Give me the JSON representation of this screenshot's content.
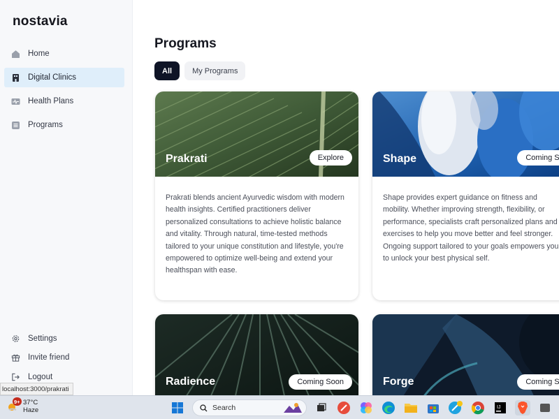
{
  "sidebar": {
    "logo": "nostavia",
    "items": [
      {
        "label": "Home",
        "icon": "home-icon"
      },
      {
        "label": "Digital Clinics",
        "icon": "clinic-icon",
        "active": true
      },
      {
        "label": "Health Plans",
        "icon": "heartbeat-icon"
      },
      {
        "label": "Programs",
        "icon": "list-icon"
      }
    ],
    "bottom_items": [
      {
        "label": "Settings",
        "icon": "gear-icon"
      },
      {
        "label": "Invite friend",
        "icon": "gift-icon"
      },
      {
        "label": "Logout",
        "icon": "logout-icon"
      }
    ]
  },
  "main": {
    "title": "Programs",
    "tabs": [
      {
        "label": "All",
        "active": true
      },
      {
        "label": "My Programs",
        "active": false
      }
    ],
    "cards": [
      {
        "name": "Prakrati",
        "button": "Explore",
        "description": "Prakrati blends ancient Ayurvedic wisdom with modern health insights. Certified practitioners deliver personalized consultations to achieve holistic balance and vitality. Through natural, time-tested methods tailored to your unique constitution and lifestyle, you're empowered to optimize well-being and extend your healthspan with ease."
      },
      {
        "name": "Shape",
        "button": "Coming Soon",
        "description": "Shape provides expert guidance on fitness and mobility. Whether improving strength, flexibility, or performance, specialists craft personalized plans and exercises to help you move better and feel stronger. Ongoing support tailored to your goals empowers you to unlock your best physical self."
      },
      {
        "name": "Radience",
        "button": "Coming Soon"
      },
      {
        "name": "Forge",
        "button": "Coming Soon"
      }
    ]
  },
  "status_url": "localhost:3000/prakrati",
  "taskbar": {
    "weather_temp": "37°C",
    "weather_desc": "Haze",
    "weather_badge": "9+",
    "search_placeholder": "Search"
  },
  "colors": {
    "active_nav_bg": "#dfeefa",
    "active_tab_bg": "#0f1426",
    "sidebar_bg": "#f7f8fa"
  }
}
